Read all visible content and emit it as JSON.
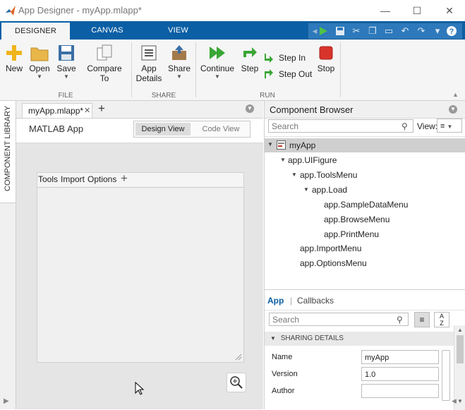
{
  "window": {
    "title": "App Designer - myApp.mlapp*"
  },
  "tabs": [
    {
      "label": "DESIGNER"
    },
    {
      "label": "CANVAS"
    },
    {
      "label": "VIEW"
    }
  ],
  "ribbon": {
    "file": {
      "group_label": "FILE",
      "new": "New",
      "open": "Open",
      "save": "Save",
      "compare_to": "Compare To"
    },
    "share": {
      "group_label": "SHARE",
      "app_details_line1": "App",
      "app_details_line2": "Details",
      "share": "Share"
    },
    "run": {
      "group_label": "RUN",
      "continue": "Continue",
      "step": "Step",
      "step_in": "Step In",
      "step_out": "Step Out",
      "stop": "Stop"
    }
  },
  "left_strip": {
    "label": "COMPONENT LIBRARY"
  },
  "editor": {
    "doc_tab": "myApp.mlapp*",
    "app_type": "MATLAB App",
    "design_view": "Design View",
    "code_view": "Code View"
  },
  "uifigure": {
    "menus": [
      "Tools",
      "Import",
      "Options"
    ]
  },
  "browser": {
    "title": "Component Browser",
    "search_placeholder": "Search",
    "view_label": "View:",
    "tree": [
      "myApp",
      "app.UIFigure",
      "app.ToolsMenu",
      "app.Load",
      "app.SampleDataMenu",
      "app.BrowseMenu",
      "app.PrintMenu",
      "app.ImportMenu",
      "app.OptionsMenu"
    ]
  },
  "inspector": {
    "tab_app": "App",
    "tab_callbacks": "Callbacks",
    "search_placeholder": "Search",
    "section": "SHARING DETAILS",
    "props": [
      {
        "label": "Name",
        "value": "myApp"
      },
      {
        "label": "Version",
        "value": "1.0"
      },
      {
        "label": "Author",
        "value": ""
      }
    ]
  },
  "colors": {
    "tabstrip": "#0b5fa5",
    "accent": "#0b5fa5",
    "run_green": "#3aa635",
    "stop_red": "#d9342b"
  }
}
